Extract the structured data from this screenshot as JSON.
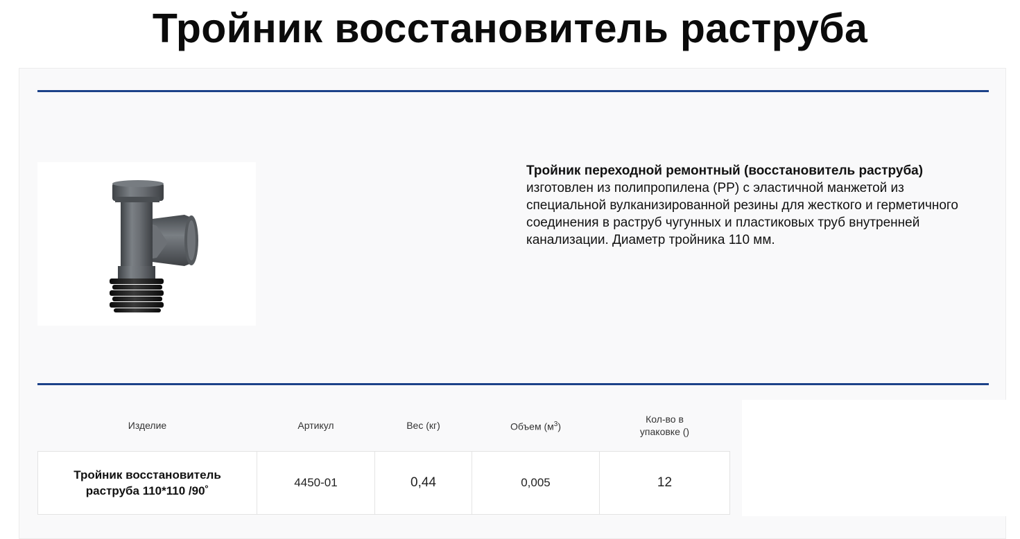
{
  "page": {
    "title": "Тройник восстановитель раструба"
  },
  "product": {
    "description_bold": "Тройник переходной ремонтный (восстановитель раструба)",
    "description_rest": " изготовлен из полипропилена (PP) с эластичной манжетой из специальной вулканизированной резины для жесткого и герметичного соединения в раструб чугунных и пластиковых труб внутренней канализации. Диаметр тройника 110 мм.",
    "image_icon": "tee-pipe-fitting-image"
  },
  "specs": {
    "headers": {
      "product": "Изделие",
      "article": "Артикул",
      "weight": "Вес (кг)",
      "volume_prefix": "Объем (м",
      "volume_sup": "3",
      "volume_suffix": ")",
      "qty_line1": "Кол-во в",
      "qty_line2": "упаковке ()"
    },
    "row": {
      "name_line1": "Тройник восстановитель",
      "name_line2": "раструба 110*110 /90˚",
      "article": "4450-01",
      "weight": "0,44",
      "volume": "0,005",
      "qty": "12"
    }
  },
  "colors": {
    "accent_rule": "#1c4289",
    "card_bg": "#f9f9fa",
    "plastic_gray": "#5f6368",
    "rubber_black": "#1a1a1a"
  }
}
